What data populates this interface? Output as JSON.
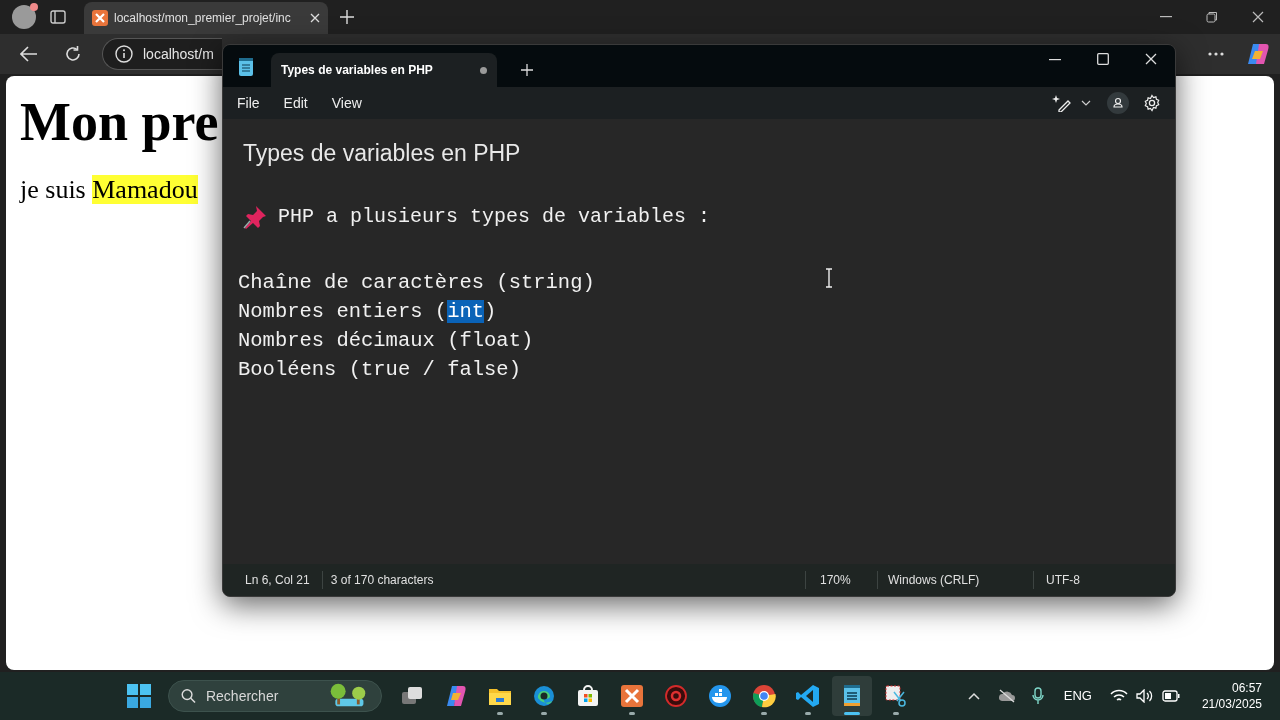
{
  "browser": {
    "tab": {
      "title": "localhost/mon_premier_projet/inc",
      "selected": true
    },
    "address": "localhost/m",
    "page": {
      "heading": "Mon pre",
      "paragraph": [
        {
          "text": "je suis ",
          "highlighted": false
        },
        {
          "text": "Mamadou",
          "highlighted": true
        }
      ]
    }
  },
  "notepad": {
    "tab": {
      "title": "Types de variables en PHP",
      "modified": true
    },
    "menu": [
      "File",
      "Edit",
      "View"
    ],
    "heading": "Types de variables en PHP",
    "pinned_line": "PHP a plusieurs types de variables :",
    "lines": [
      [
        {
          "text": "Chaîne de caractères (string)",
          "selected": false
        }
      ],
      [
        {
          "text": "Nombres entiers (",
          "selected": false
        },
        {
          "text": "int",
          "selected": true
        },
        {
          "text": ")",
          "selected": false
        }
      ],
      [
        {
          "text": "Nombres décimaux (float)",
          "selected": false
        }
      ],
      [
        {
          "text": "Booléens (true / false)",
          "selected": false
        }
      ]
    ],
    "status_bar": {
      "position": "Ln 6, Col 21",
      "characters": "3 of 170 characters",
      "zoom": "170%",
      "line_ending": "Windows (CRLF)",
      "encoding": "UTF-8"
    }
  },
  "taskbar": {
    "search": {
      "placeholder": "Rechercher"
    },
    "apps": [
      {
        "kind": "taskview",
        "running": false,
        "selected": false
      },
      {
        "kind": "copilot",
        "running": false,
        "selected": false
      },
      {
        "kind": "explorer",
        "running": true,
        "selected": false
      },
      {
        "kind": "edge",
        "running": true,
        "selected": false
      },
      {
        "kind": "store",
        "running": false,
        "selected": false
      },
      {
        "kind": "xampp",
        "running": true,
        "selected": false
      },
      {
        "kind": "gamepad",
        "running": false,
        "selected": false
      },
      {
        "kind": "docker",
        "running": false,
        "selected": false
      },
      {
        "kind": "chrome",
        "running": true,
        "selected": false
      },
      {
        "kind": "vscode",
        "running": true,
        "selected": false
      },
      {
        "kind": "notepad",
        "running": true,
        "selected": true
      },
      {
        "kind": "snipping",
        "running": true,
        "selected": false
      }
    ],
    "language": "ENG",
    "time": "06:57",
    "date": "21/03/2025"
  }
}
